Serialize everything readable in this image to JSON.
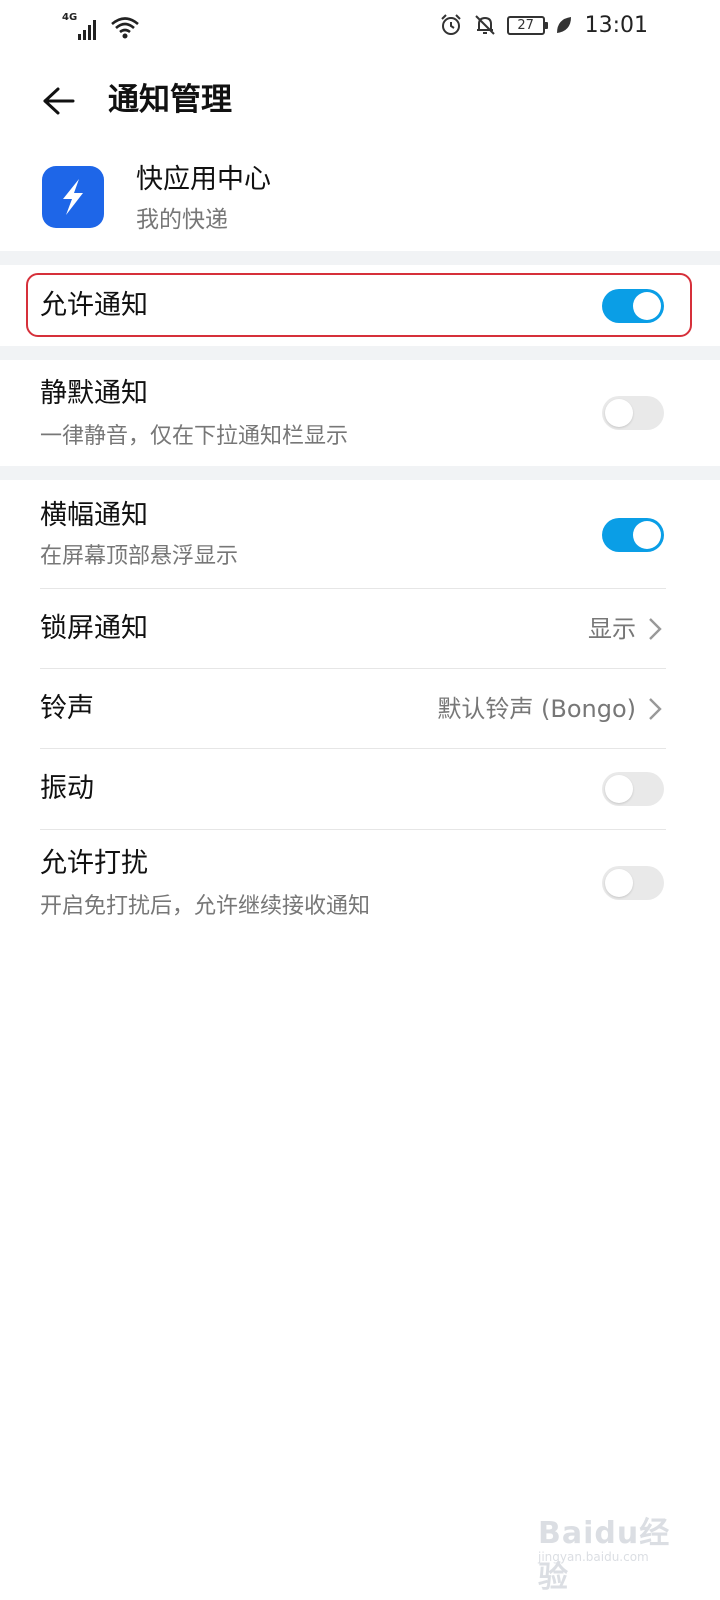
{
  "status_bar": {
    "network_type": "4G",
    "battery_level": "27",
    "time": "13:01",
    "icons": [
      "signal-icon",
      "wifi-icon",
      "alarm-icon",
      "mute-icon",
      "battery-icon",
      "leaf-icon"
    ]
  },
  "header": {
    "title": "通知管理",
    "back_icon": "back-arrow-icon"
  },
  "app": {
    "name": "快应用中心",
    "subtitle": "我的快递",
    "icon": "lightning-app-icon",
    "icon_color": "#1e66e8"
  },
  "settings": {
    "allow_notifications": {
      "title": "允许通知",
      "enabled": true
    },
    "silent_notifications": {
      "title": "静默通知",
      "subtitle": "一律静音，仅在下拉通知栏显示",
      "enabled": false
    },
    "banner_notifications": {
      "title": "横幅通知",
      "subtitle": "在屏幕顶部悬浮显示",
      "enabled": true
    },
    "lock_screen": {
      "title": "锁屏通知",
      "value": "显示"
    },
    "ringtone": {
      "title": "铃声",
      "value": "默认铃声 (Bongo)"
    },
    "vibration": {
      "title": "振动",
      "enabled": false
    },
    "allow_dnd": {
      "title": "允许打扰",
      "subtitle": "开启免打扰后，允许继续接收通知",
      "enabled": false
    }
  },
  "colors": {
    "toggle_on": "#0a9ee6",
    "toggle_off": "#e9e9e9",
    "highlight": "#d6303a"
  },
  "watermark": {
    "text": "Baidu经验",
    "url": "jingyan.baidu.com"
  }
}
